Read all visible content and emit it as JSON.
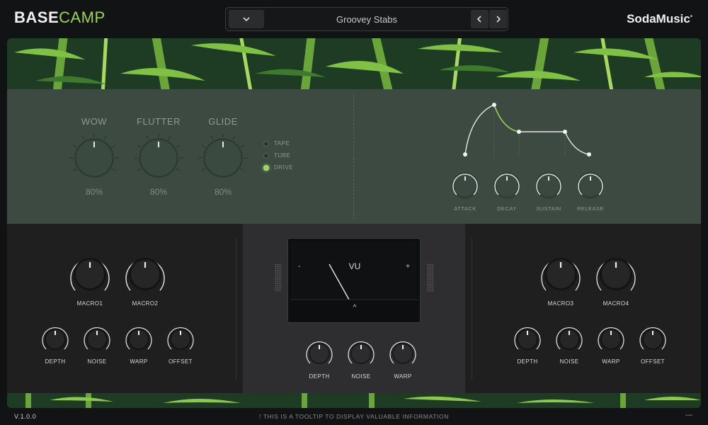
{
  "header": {
    "brand_bold": "BASE",
    "brand_light": "CAMP",
    "preset_name": "Groovey Stabs",
    "company": "SodaMusic",
    "company_mark": "•"
  },
  "top_panel": {
    "knobs": [
      {
        "label": "WOW",
        "value": "80%"
      },
      {
        "label": "FLUTTER",
        "value": "80%"
      },
      {
        "label": "GLIDE",
        "value": "80%"
      }
    ],
    "modes": [
      {
        "label": "TAPE",
        "active": false
      },
      {
        "label": "TUBE",
        "active": false
      },
      {
        "label": "DRIVE",
        "active": true
      }
    ],
    "envelope": {
      "labels": [
        "ATTACK",
        "DECAY",
        "SUSTAIN",
        "RELEASE"
      ]
    }
  },
  "left_section": {
    "macros": [
      "MACRO1",
      "MACRO2"
    ],
    "knobs": [
      "DEPTH",
      "NOISE",
      "WARP",
      "OFFSET"
    ]
  },
  "center_section": {
    "vu": {
      "title": "VU",
      "minus": "-",
      "plus": "+",
      "caret": "^"
    },
    "knobs": [
      "DEPTH",
      "NOISE",
      "WARP"
    ]
  },
  "right_section": {
    "macros": [
      "MACRO3",
      "MACRO4"
    ],
    "knobs": [
      "DEPTH",
      "NOISE",
      "WARP",
      "OFFSET"
    ]
  },
  "footer": {
    "version": "V.1.0.0",
    "tooltip": "! THIS IS A TOOLTIP TO DISPLAY VALUABLE INFORMATION",
    "extra": "---"
  },
  "colors": {
    "accent": "#9bd356",
    "panel_green": "#3c4a42",
    "dark_bg": "#121314"
  }
}
